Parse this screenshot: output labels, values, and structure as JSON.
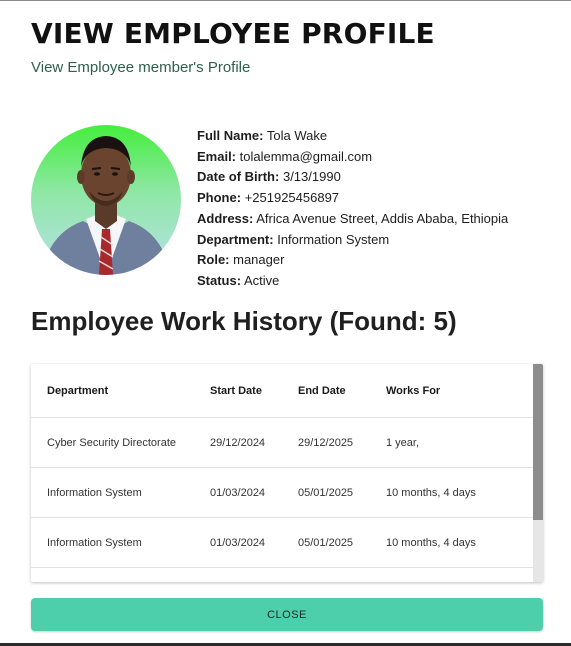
{
  "header": {
    "title": "VIEW EMPLOYEE PROFILE",
    "subtitle": "View Employee member's Profile"
  },
  "profile": {
    "fields": [
      {
        "label": "Full Name:",
        "value": "Tola Wake"
      },
      {
        "label": "Email:",
        "value": "tolalemma@gmail.com"
      },
      {
        "label": "Date of Birth:",
        "value": "3/13/1990"
      },
      {
        "label": "Phone:",
        "value": "+251925456897"
      },
      {
        "label": "Address:",
        "value": "Africa Avenue Street, Addis Ababa, Ethiopia"
      },
      {
        "label": "Department:",
        "value": "Information System"
      },
      {
        "label": "Role:",
        "value": "manager"
      },
      {
        "label": "Status:",
        "value": "Active"
      }
    ]
  },
  "history": {
    "title": "Employee Work History (Found: 5)",
    "columns": [
      "Department",
      "Start Date",
      "End Date",
      "Works For"
    ],
    "rows": [
      [
        "Cyber Security Directorate",
        "29/12/2024",
        "29/12/2025",
        "1 year,"
      ],
      [
        "Information System",
        "01/03/2024",
        "05/01/2025",
        "10 months, 4 days"
      ],
      [
        "Information System",
        "01/03/2024",
        "05/01/2025",
        "10 months, 4 days"
      ]
    ]
  },
  "actions": {
    "close_label": "CLOSE"
  },
  "colors": {
    "accent": "#4ecfab",
    "subtitle": "#2e5e4e"
  }
}
